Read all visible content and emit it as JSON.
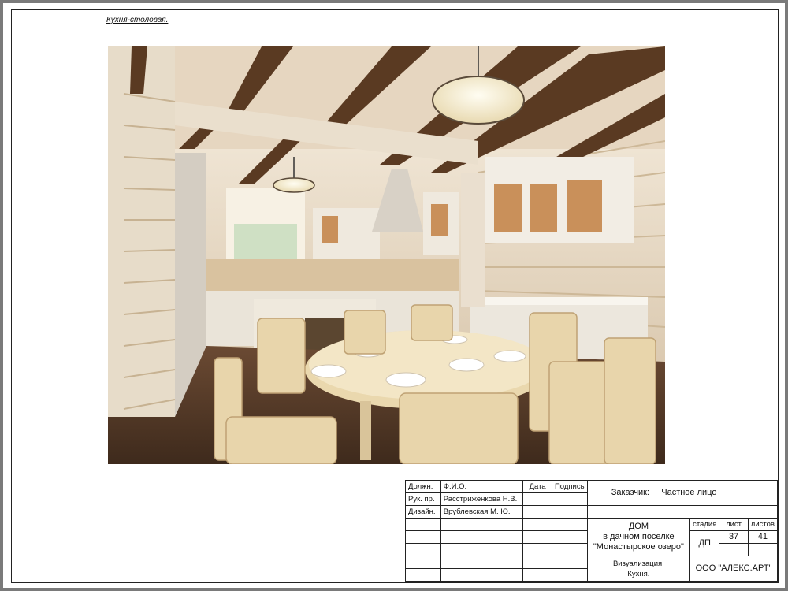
{
  "caption": "Кухня-столовая.",
  "title_block": {
    "col_position": "Должн.",
    "col_name": "Ф.И.О.",
    "col_date": "Дата",
    "col_signature": "Подпись",
    "row1_role": "Рук. пр.",
    "row1_name": "Расстриженкова Н.В.",
    "row2_role": "Дизайн.",
    "row2_name": "Врублевская М. Ю.",
    "customer_label": "Заказчик:",
    "customer_value": "Частное лицо",
    "project_line1": "ДОМ",
    "project_line2": "в дачном поселке",
    "project_line3": "\"Монастырское озеро\"",
    "stage_label": "стадия",
    "sheet_label": "лист",
    "sheets_label": "листов",
    "stage_value": "ДП",
    "sheet_value": "37",
    "sheets_value": "41",
    "drawing_line1": "Визуализация.",
    "drawing_line2": "Кухня.",
    "company": "ООО \"АЛЕКС.АРТ\""
  }
}
